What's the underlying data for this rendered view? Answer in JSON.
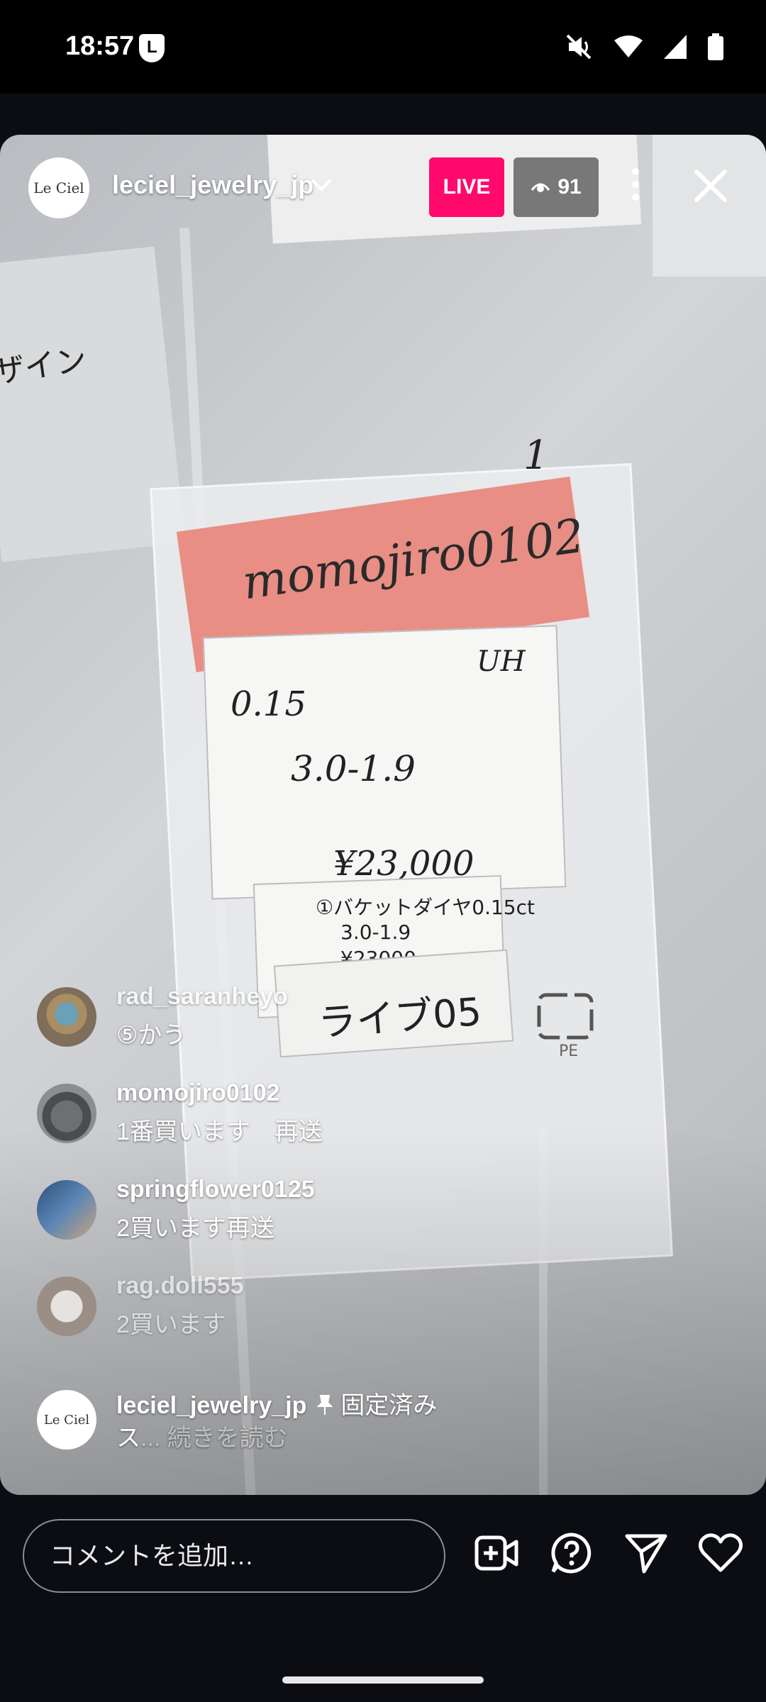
{
  "status_bar": {
    "time": "18:57"
  },
  "live": {
    "host_username": "leciel_jewelry_jp",
    "host_avatar_text": "Le Ciel",
    "live_label": "LIVE",
    "viewer_count": "91"
  },
  "video_scene": {
    "pink_note": "momojiro0102",
    "pink_note_number": "1",
    "card_lines": [
      "0.15",
      "UH",
      "3.0-1.9",
      "¥23,000"
    ],
    "printed_label": [
      "①バケットダイヤ0.15ct",
      "3.0-1.9",
      "¥23000"
    ],
    "bottom_label": "ライブ05",
    "left_text": "ザイン",
    "recycle_mark": "PE"
  },
  "comments": [
    {
      "user": "rad_saranheyo",
      "text": "⑤かう"
    },
    {
      "user": "momojiro0102",
      "text": "1番買います　再送"
    },
    {
      "user": "springflower0125",
      "text": "2買います再送"
    },
    {
      "user": "rag.doll555",
      "text": "2買います"
    }
  ],
  "pinned_comment": {
    "user": "leciel_jewelry_jp",
    "pinned_label": "固定済み",
    "text": "ス",
    "more_label": "... 続きを読む"
  },
  "bottom_bar": {
    "comment_placeholder": "コメントを追加…"
  },
  "colors": {
    "live_badge": "#ff0a6c",
    "background": "#0b0d12"
  }
}
